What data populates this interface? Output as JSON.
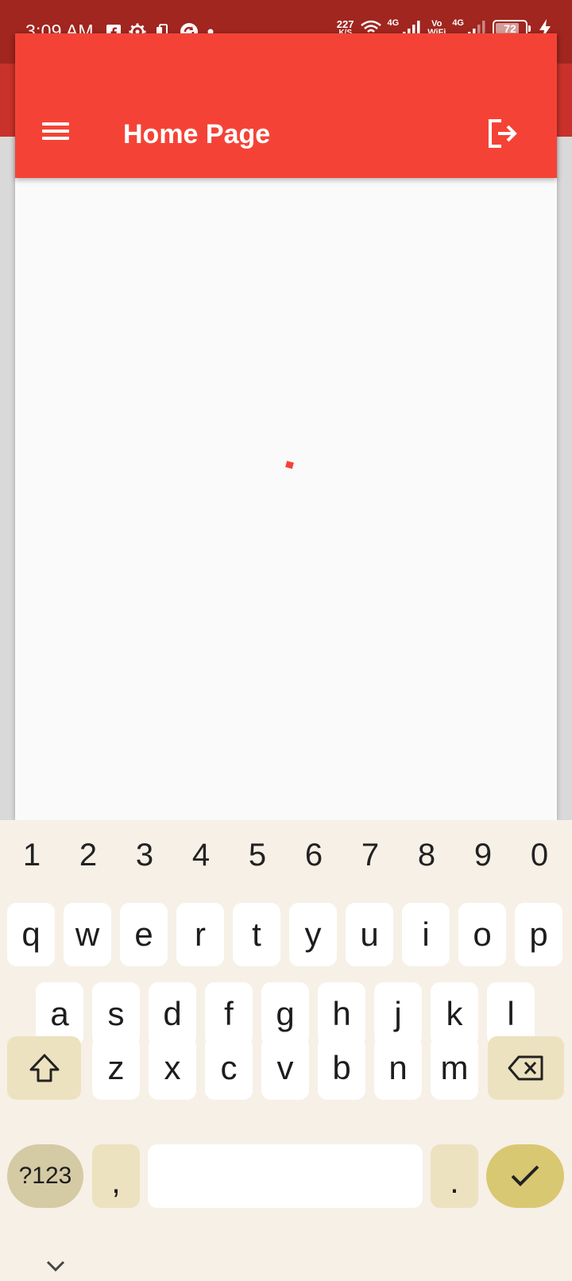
{
  "status_bar": {
    "time": "3:09 AM",
    "net_speed_value": "227",
    "net_speed_unit": "K/S",
    "network_tag_1": "4G",
    "vowifi_top": "Vo",
    "vowifi_bottom": "WiFi",
    "network_tag_2": "4G",
    "battery_level": "72",
    "icons_left": [
      "facebook-icon",
      "settings-icon",
      "phone-clone-icon",
      "sync-icon",
      "dot-icon"
    ],
    "icons_right": [
      "wifi-icon",
      "signal-icon",
      "signal-icon",
      "battery-icon",
      "charging-icon"
    ]
  },
  "app_bar": {
    "title": "Home Page",
    "menu_icon": "hamburger-menu-icon",
    "action_icon": "logout-icon"
  },
  "colors": {
    "primary": "#f44336",
    "status_bar": "#a0261f",
    "keyboard_bg": "#f6f0e7",
    "enter_key": "#d9c872"
  },
  "keyboard": {
    "number_row": [
      "1",
      "2",
      "3",
      "4",
      "5",
      "6",
      "7",
      "8",
      "9",
      "0"
    ],
    "row1": [
      "q",
      "w",
      "e",
      "r",
      "t",
      "y",
      "u",
      "i",
      "o",
      "p"
    ],
    "row2": [
      "a",
      "s",
      "d",
      "f",
      "g",
      "h",
      "j",
      "k",
      "l"
    ],
    "row3": [
      "z",
      "x",
      "c",
      "v",
      "b",
      "n",
      "m"
    ],
    "symbols_label": "?123",
    "comma_label": ",",
    "period_label": ".",
    "shift_icon": "shift-icon",
    "backspace_icon": "backspace-icon",
    "enter_icon": "checkmark-icon",
    "collapse_icon": "chevron-down-icon"
  }
}
